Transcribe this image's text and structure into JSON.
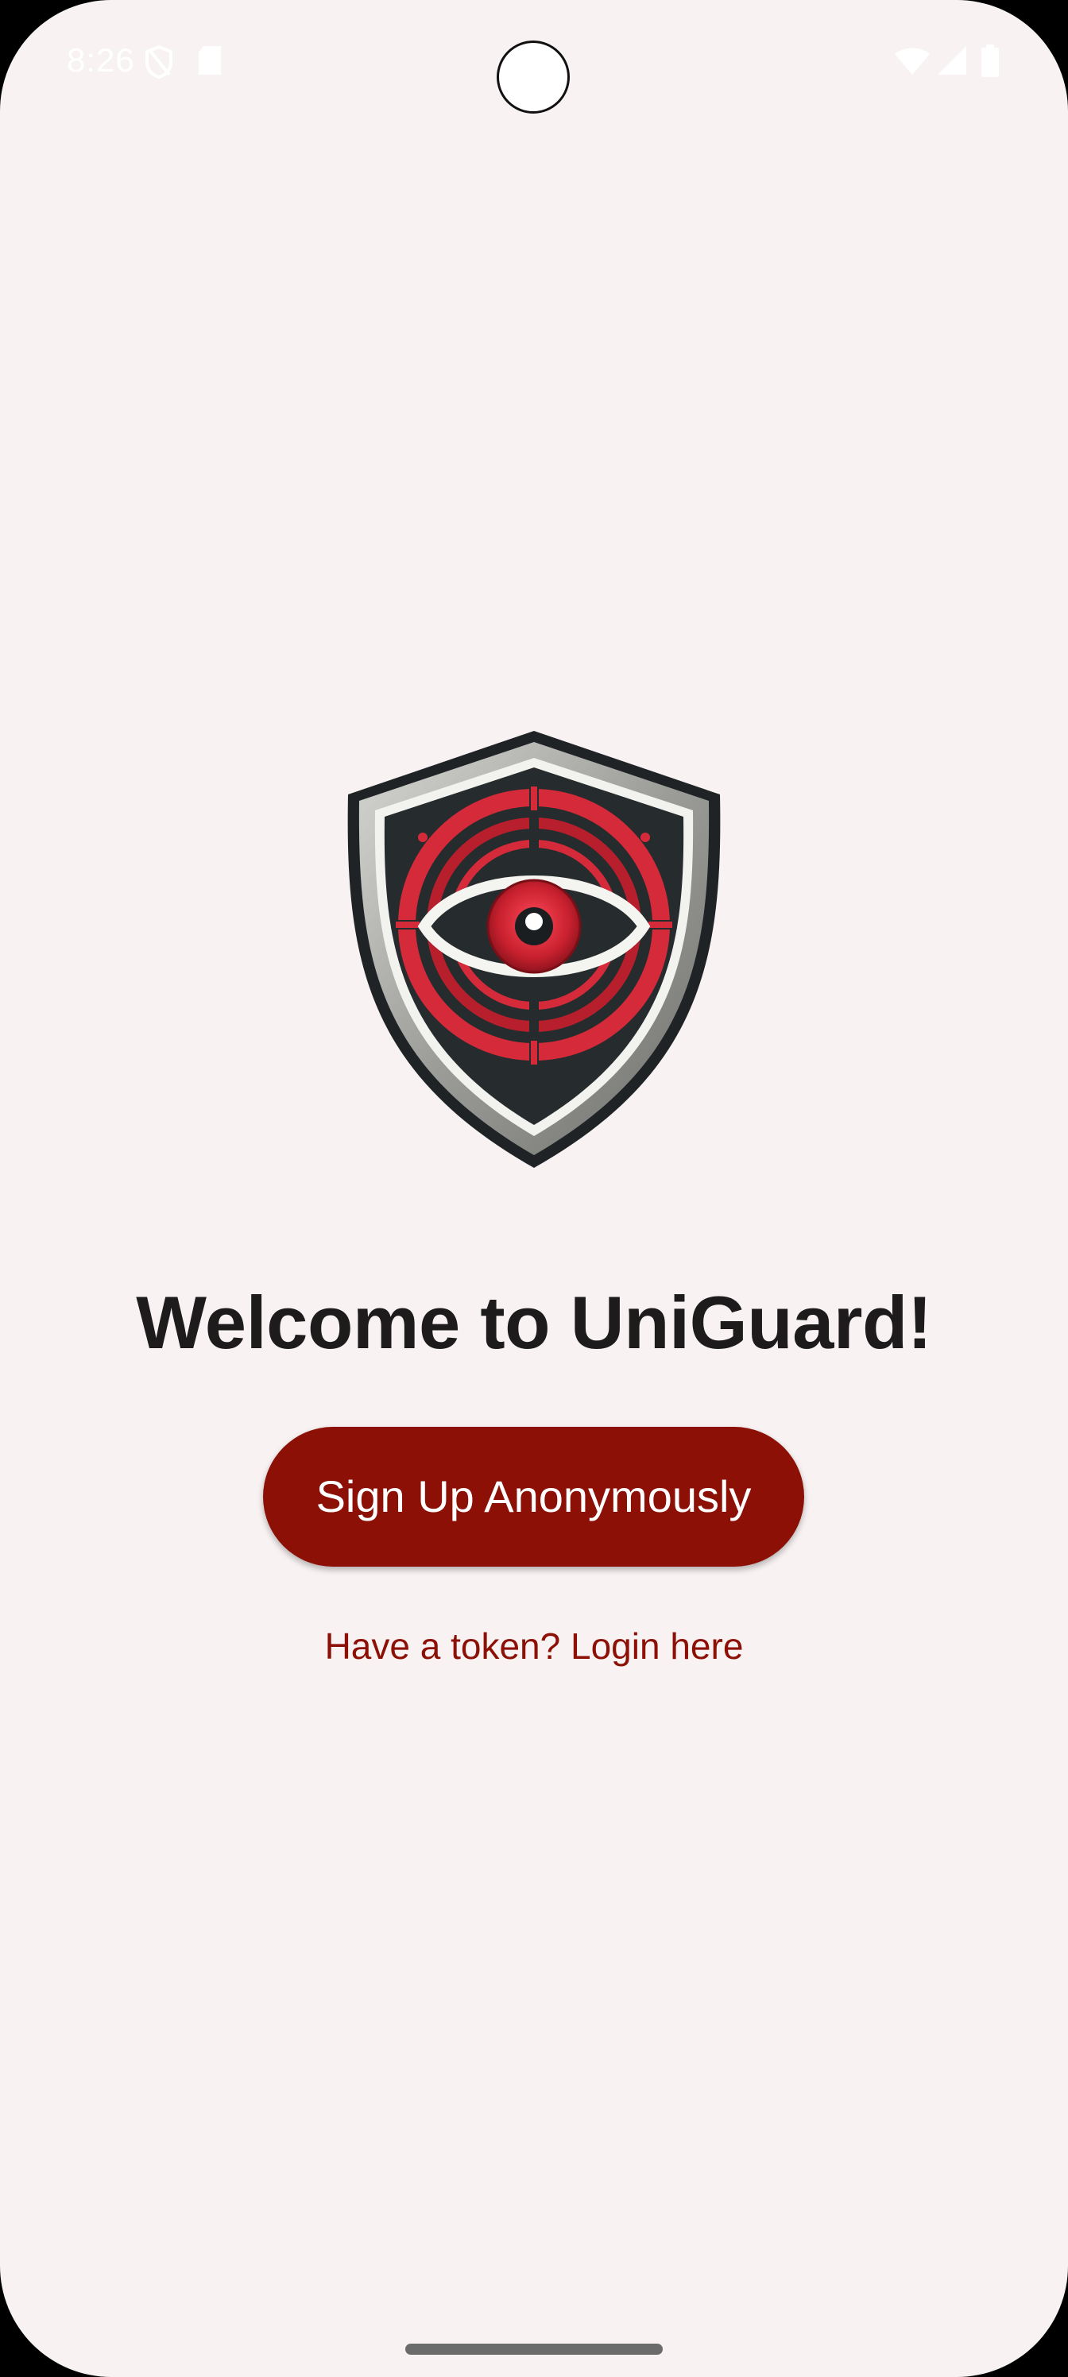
{
  "status_bar": {
    "time": "8:26",
    "icons": [
      "vpn-shield-icon",
      "sd-card-icon",
      "wifi-icon",
      "cell-signal-icon",
      "battery-icon"
    ]
  },
  "main": {
    "logo_icon": "shield-eye-logo",
    "title": "Welcome to UniGuard!",
    "signup_label": "Sign Up Anonymously",
    "login_link": "Have a token? Login here"
  },
  "colors": {
    "background": "#f8f2f2",
    "primary": "#8c1006",
    "title_text": "#1d1b1c",
    "logo_red": "#d52a3a",
    "logo_dark": "#23282b",
    "logo_silver": "#a5a6a2"
  }
}
